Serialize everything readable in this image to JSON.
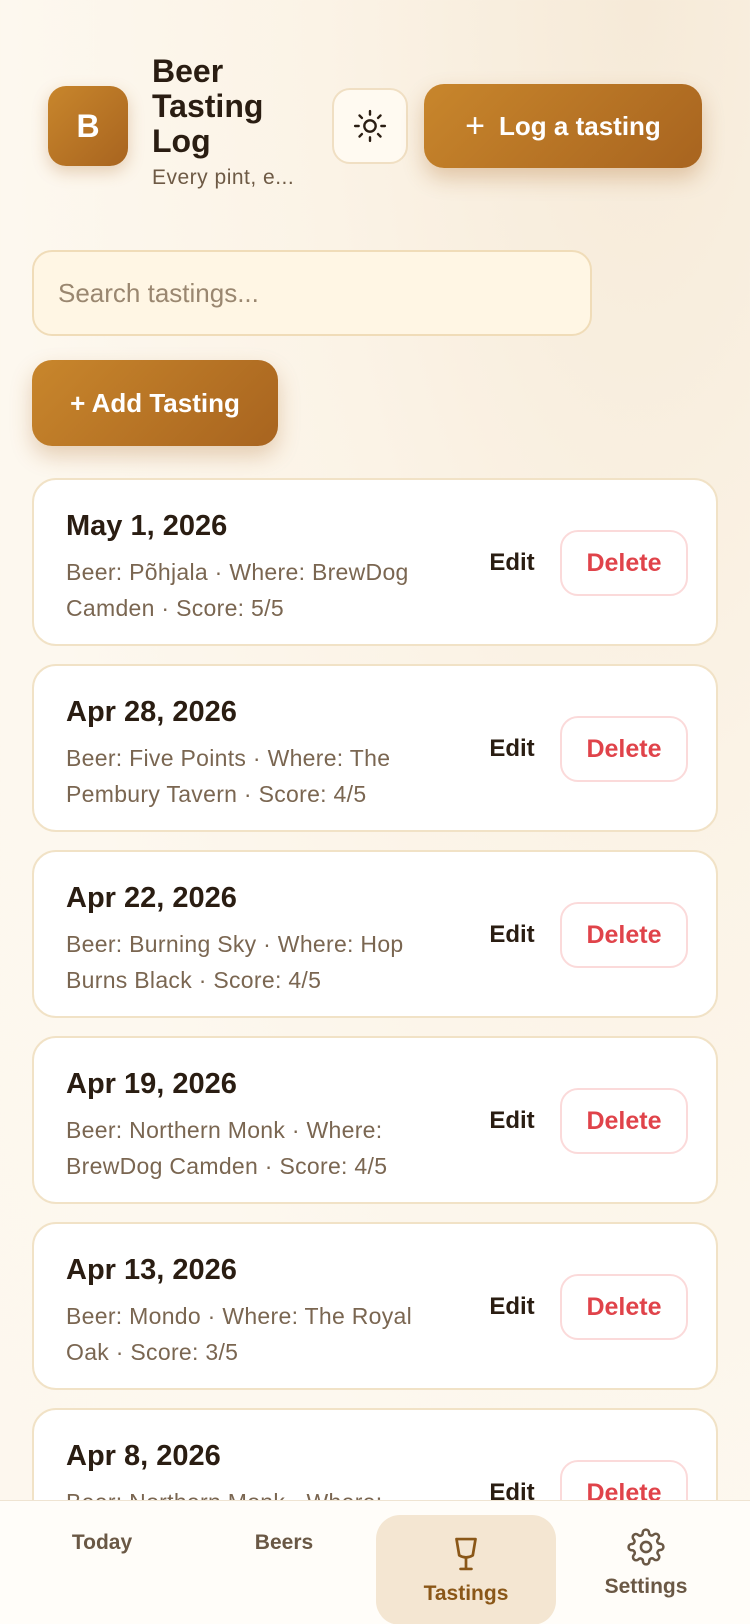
{
  "header": {
    "logo_letter": "B",
    "title": "Beer Tasting Log",
    "subtitle": "Every pint, e...",
    "theme_icon": "sun-icon",
    "log_button_label": "Log a tasting",
    "log_button_icon": "plus-icon"
  },
  "search": {
    "placeholder": "Search tastings...",
    "value": ""
  },
  "add_button_label": "+ Add Tasting",
  "tastings": [
    {
      "date": "May 1, 2026",
      "meta": "Beer: Põhjala · Where: BrewDog Camden · Score: 5/5",
      "edit": "Edit",
      "delete": "Delete"
    },
    {
      "date": "Apr 28, 2026",
      "meta": "Beer: Five Points · Where: The Pembury Tavern · Score: 4/5",
      "edit": "Edit",
      "delete": "Delete"
    },
    {
      "date": "Apr 22, 2026",
      "meta": "Beer: Burning Sky · Where: Hop Burns Black · Score: 4/5",
      "edit": "Edit",
      "delete": "Delete"
    },
    {
      "date": "Apr 19, 2026",
      "meta": "Beer: Northern Monk · Where: BrewDog Camden · Score: 4/5",
      "edit": "Edit",
      "delete": "Delete"
    },
    {
      "date": "Apr 13, 2026",
      "meta": "Beer: Mondo · Where: The Royal Oak · Score: 3/5",
      "edit": "Edit",
      "delete": "Delete"
    },
    {
      "date": "Apr 8, 2026",
      "meta": "Beer: Northern Monk · Where:",
      "edit": "Edit",
      "delete": "Delete"
    }
  ],
  "nav": {
    "items": [
      {
        "label": "Today",
        "icon": "",
        "active": false
      },
      {
        "label": "Beers",
        "icon": "",
        "active": false
      },
      {
        "label": "Tastings",
        "icon": "glass-icon",
        "active": true
      },
      {
        "label": "Settings",
        "icon": "gear-icon",
        "active": false
      }
    ]
  },
  "colors": {
    "accent": "#b8772a",
    "danger": "#e0434a",
    "background": "#fdf7ee"
  }
}
